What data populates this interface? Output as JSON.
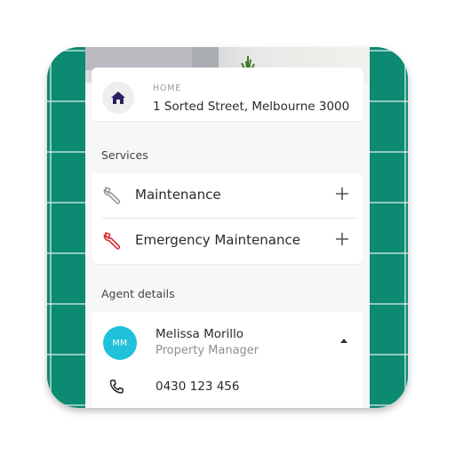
{
  "home": {
    "label": "HOME",
    "address": "1 Sorted Street, Melbourne 3000"
  },
  "services": {
    "title": "Services",
    "items": [
      {
        "label": "Maintenance",
        "icon": "wrench-icon",
        "icon_color": "#9a9a9a"
      },
      {
        "label": "Emergency Maintenance",
        "icon": "wrench-icon",
        "icon_color": "#e0303a"
      }
    ]
  },
  "agent": {
    "title": "Agent details",
    "initials": "MM",
    "name": "Melissa Morillo",
    "role": "Property Manager",
    "phone": "0430 123 456"
  },
  "colors": {
    "tile_background": "#0c8a72",
    "avatar": "#1fc2d8",
    "emergency": "#e0303a",
    "home_icon": "#2b1f66"
  }
}
